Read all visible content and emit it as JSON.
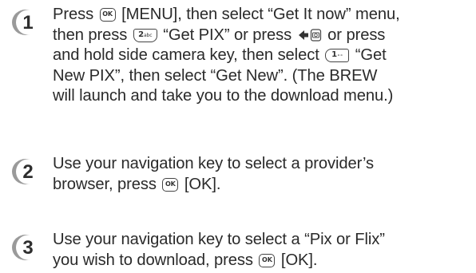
{
  "steps": [
    {
      "number": "1",
      "lines": [
        {
          "parts": [
            "Press ",
            "{ok}",
            " [MENU], then select “Get It now” menu,"
          ]
        },
        {
          "parts": [
            "then press ",
            "{2}",
            " “Get PIX” or press ",
            "{nav-left}",
            " or press"
          ]
        },
        {
          "parts": [
            "and hold side camera key, then select ",
            "{1}",
            " “Get"
          ]
        },
        {
          "parts": [
            "New PIX”, then select “Get New”. (The BREW"
          ]
        },
        {
          "parts": [
            "will launch and take you to the download menu.)"
          ]
        }
      ]
    },
    {
      "number": "2",
      "lines": [
        {
          "parts": [
            "Use your navigation key to select a provider’s"
          ]
        },
        {
          "parts": [
            "browser, press ",
            "{ok}",
            " [OK]."
          ]
        }
      ]
    },
    {
      "number": "3",
      "lines": [
        {
          "parts": [
            "Use your navigation key to select a “Pix or Flix”"
          ]
        },
        {
          "parts": [
            "you wish to download, press ",
            "{ok}",
            " [OK]."
          ]
        }
      ]
    }
  ],
  "keys": {
    "ok": "OK",
    "two": "2",
    "two_sub": "abc",
    "one": "1",
    "one_sub": "∘∘"
  },
  "colors": {
    "badge_fill": "#2e2e2e",
    "badge_shadow": "#9a9a9a",
    "text": "#2a2a2a"
  }
}
